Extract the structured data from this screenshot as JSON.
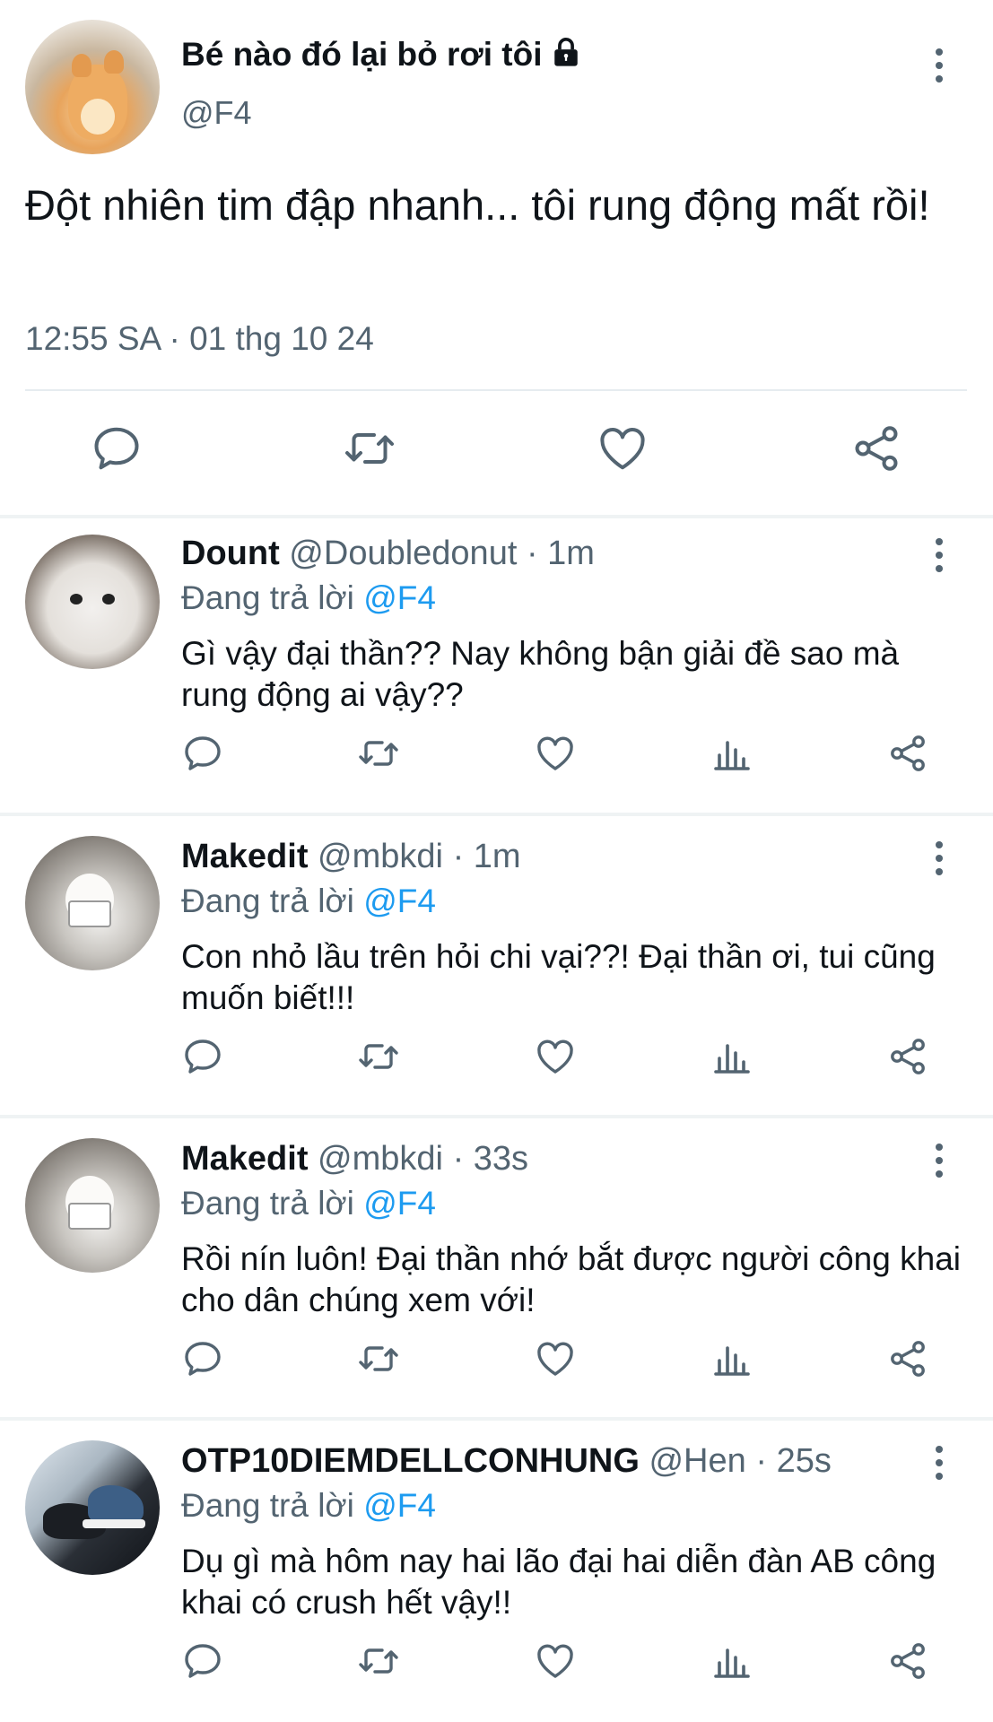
{
  "main_tweet": {
    "display_name": "Bé nào đó lại bỏ rơi tôi",
    "handle": "@F4",
    "text": "Đột nhiên tim đập nhanh... tôi rung động mất rồi!",
    "timestamp": "12:55 SA · 01 thg 10 24",
    "actions": [
      "reply-icon",
      "retweet-icon",
      "like-icon",
      "share-icon"
    ]
  },
  "replies": [
    {
      "name": "Dount",
      "handle": "@Doubledonut",
      "separator": "·",
      "time": "1m",
      "replying_prefix": "Đang trả lời",
      "replying_to": "@F4",
      "text": "Gì vậy đại thần?? Nay không bận giải đề sao mà rung động ai vậy??"
    },
    {
      "name": "Makedit",
      "handle": "@mbkdi",
      "separator": "·",
      "time": "1m",
      "replying_prefix": "Đang trả lời",
      "replying_to": "@F4",
      "text": "Con nhỏ lầu trên hỏi chi vại??! Đại thần ơi, tui cũng muốn biết!!!"
    },
    {
      "name": "Makedit",
      "handle": "@mbkdi",
      "separator": "·",
      "time": "33s",
      "replying_prefix": "Đang trả lời",
      "replying_to": "@F4",
      "text": "Rồi nín luôn! Đại thần nhớ bắt được người công khai cho dân chúng xem với!"
    },
    {
      "name": "OTP10DIEMDELLCONHUNG",
      "handle": "@Hen",
      "separator": "·",
      "time": "25s",
      "replying_prefix": "Đang trả lời",
      "replying_to": "@F4",
      "text": "Dụ gì mà hôm nay hai lão đại hai diễn đàn AB công khai có crush hết vậy!!"
    }
  ],
  "colors": {
    "text": "#0f1419",
    "secondary": "#536471",
    "mention": "#1d9bf0",
    "divider": "#eff3f4"
  }
}
